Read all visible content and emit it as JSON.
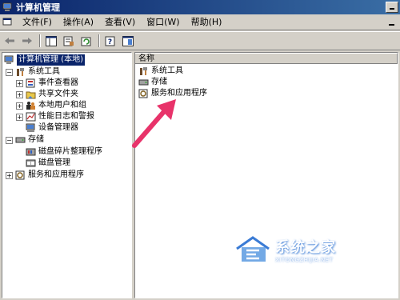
{
  "window": {
    "title": "计算机管理"
  },
  "menu": {
    "items": [
      "文件(F)",
      "操作(A)",
      "查看(V)",
      "窗口(W)",
      "帮助(H)"
    ]
  },
  "toolbar": {
    "buttons": [
      "back-icon",
      "forward-icon",
      "show-hide-tree-icon",
      "properties-icon",
      "refresh-icon",
      "help-icon",
      "action-pane-icon"
    ]
  },
  "tree": {
    "items": [
      {
        "label": "计算机管理 (本地)",
        "icon": "computer-icon",
        "selected": true
      },
      {
        "label": "系统工具",
        "icon": "tools-icon",
        "expander": "−"
      },
      {
        "label": "事件查看器",
        "icon": "event-viewer-icon",
        "expander": "+"
      },
      {
        "label": "共享文件夹",
        "icon": "shared-folder-icon",
        "expander": "+"
      },
      {
        "label": "本地用户和组",
        "icon": "users-icon",
        "expander": "+"
      },
      {
        "label": "性能日志和警报",
        "icon": "performance-icon",
        "expander": "+"
      },
      {
        "label": "设备管理器",
        "icon": "device-manager-icon"
      },
      {
        "label": "存储",
        "icon": "storage-icon",
        "expander": "−"
      },
      {
        "label": "磁盘碎片整理程序",
        "icon": "defrag-icon"
      },
      {
        "label": "磁盘管理",
        "icon": "disk-management-icon"
      },
      {
        "label": "服务和应用程序",
        "icon": "services-icon",
        "expander": "+"
      }
    ]
  },
  "list": {
    "column_header": "名称",
    "items": [
      {
        "label": "系统工具",
        "icon": "tools-icon"
      },
      {
        "label": "存储",
        "icon": "storage-icon"
      },
      {
        "label": "服务和应用程序",
        "icon": "services-icon"
      }
    ]
  },
  "watermark": {
    "title": "系统之家",
    "subtitle": "XITONGZHIJIA.NET"
  },
  "colors": {
    "title_bar": "#0a246a",
    "selection": "#0a246a",
    "arrow": "#e8336a",
    "watermark": "#3a7bd5"
  }
}
